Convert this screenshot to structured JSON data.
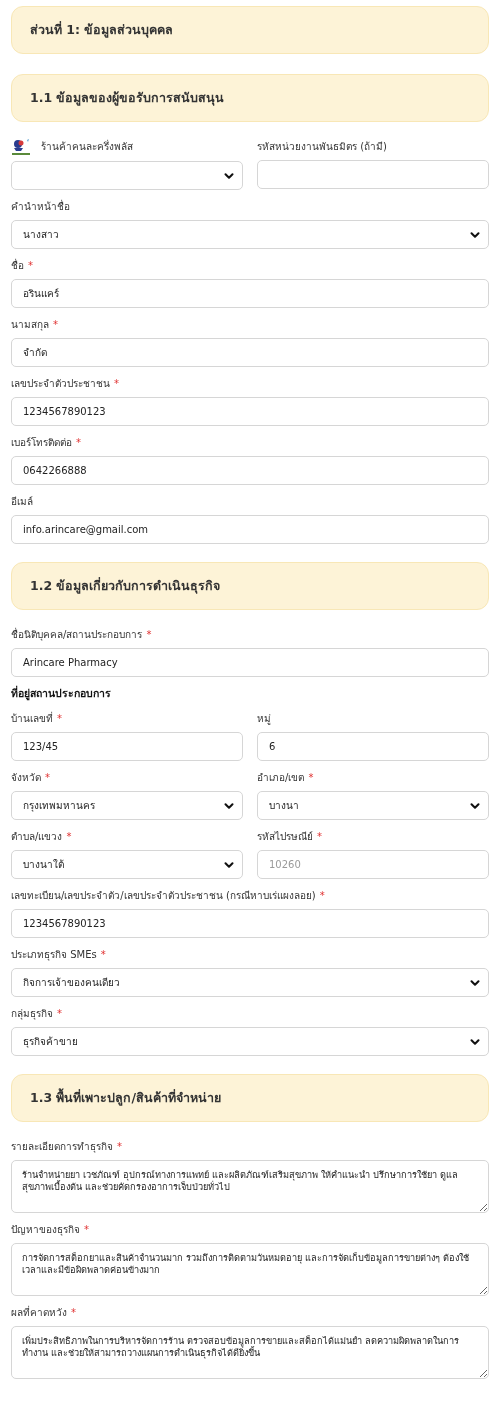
{
  "sections": [
    {
      "title": "ส่วนที่ 1: ข้อมูลส่วนบุคคล"
    },
    {
      "title": "1.1 ข้อมูลของผู้ขอรับการสนับสนุน",
      "rows": [
        [
          {
            "kind": "select",
            "label": "ร้านค้าคนละครึ่งพลัส",
            "logo": true
          },
          {
            "kind": "input",
            "label": "รหัสหน่วยงานพันธมิตร (ถ้ามี)"
          }
        ],
        [
          {
            "kind": "select",
            "label": "คำนำหน้าชื่อ",
            "value": "นางสาว"
          }
        ],
        [
          {
            "kind": "input",
            "label": "ชื่อ",
            "mark": "*",
            "value": "อรินแคร์"
          }
        ],
        [
          {
            "kind": "input",
            "label": "นามสกุล",
            "mark": "*",
            "value": "จำกัด"
          }
        ],
        [
          {
            "kind": "input",
            "label": "เลขประจำตัวประชาชน",
            "mark": "*",
            "value": "1234567890123"
          }
        ],
        [
          {
            "kind": "input",
            "label": "เบอร์โทรติดต่อ",
            "mark": "*",
            "value": "0642266888"
          }
        ],
        [
          {
            "kind": "input",
            "label": "อีเมล์",
            "value": "info.arincare@gmail.com"
          }
        ]
      ]
    },
    {
      "title": "1.2 ข้อมูลเกี่ยวกับการดำเนินธุรกิจ",
      "rows": [
        [
          {
            "kind": "input",
            "label": "ชื่อนิติบุคคล/สถานประกอบการ",
            "mark": "*",
            "value": "Arincare Pharmacy"
          }
        ],
        [
          {
            "kind": "heading",
            "label": "ที่อยู่สถานประกอบการ"
          }
        ],
        [
          {
            "kind": "input",
            "label": "บ้านเลขที่",
            "mark": "*",
            "value": "123/45"
          },
          {
            "kind": "input",
            "label": "หมู่",
            "value": "6"
          }
        ],
        [
          {
            "kind": "select",
            "label": "จังหวัด",
            "mark": "*",
            "value": "กรุงเทพมหานคร"
          },
          {
            "kind": "select",
            "label": "อำเภอ/เขต",
            "mark": "*",
            "value": "บางนา"
          }
        ],
        [
          {
            "kind": "select",
            "label": "ตำบล/แขวง",
            "mark": "*",
            "value": "บางนาใต้"
          },
          {
            "kind": "input",
            "label": "รหัสไปรษณีย์",
            "mark": "*",
            "placeholder": "10260"
          }
        ],
        [
          {
            "kind": "input",
            "label": "เลขทะเบียน/เลขประจำตัว/เลขประจำตัวประชาชน (กรณีหาบเร่แผงลอย)",
            "mark": "*",
            "value": "1234567890123"
          }
        ],
        [
          {
            "kind": "select",
            "label": "ประเภทธุรกิจ SMEs",
            "mark": "*",
            "value": "กิจการเจ้าของคนเดียว"
          }
        ],
        [
          {
            "kind": "select",
            "label": "กลุ่มธุรกิจ",
            "mark": "*",
            "value": "ธุรกิจค้าขาย"
          }
        ]
      ]
    },
    {
      "title": "1.3 พื้นที่เพาะปลูก/สินค้าที่จำหน่าย",
      "rows": [
        [
          {
            "kind": "textarea",
            "label": "รายละเอียดการทำธุรกิจ",
            "mark": "*",
            "value": "ร้านจำหน่ายยา เวชภัณฑ์ อุปกรณ์ทางการแพทย์ และผลิตภัณฑ์เสริมสุขภาพ ให้คำแนะนำ ปรึกษาการใช้ยา ดูแลสุขภาพเบื้องต้น และช่วยคัดกรองอาการเจ็บป่วยทั่วไป"
          }
        ],
        [
          {
            "kind": "textarea",
            "label": "ปัญหาของธุรกิจ",
            "mark": "*",
            "value": "การจัดการสต็อกยาและสินค้าจำนวนมาก รวมถึงการติดตามวันหมดอายุ และการจัดเก็บข้อมูลการขายต่างๆ ต้องใช้เวลาและมีข้อผิดพลาดค่อนข้างมาก"
          }
        ],
        [
          {
            "kind": "textarea",
            "label": "ผลที่คาดหวัง",
            "mark": "*",
            "value": "เพิ่มประสิทธิภาพในการบริหารจัดการร้าน ตรวจสอบข้อมูลการขายและสต็อกได้แม่นยำ ลดความผิดพลาดในการทำงาน และช่วยให้สามารถวางแผนการดำเนินธุรกิจได้ดียิ่งขึ้น"
          }
        ]
      ]
    }
  ]
}
